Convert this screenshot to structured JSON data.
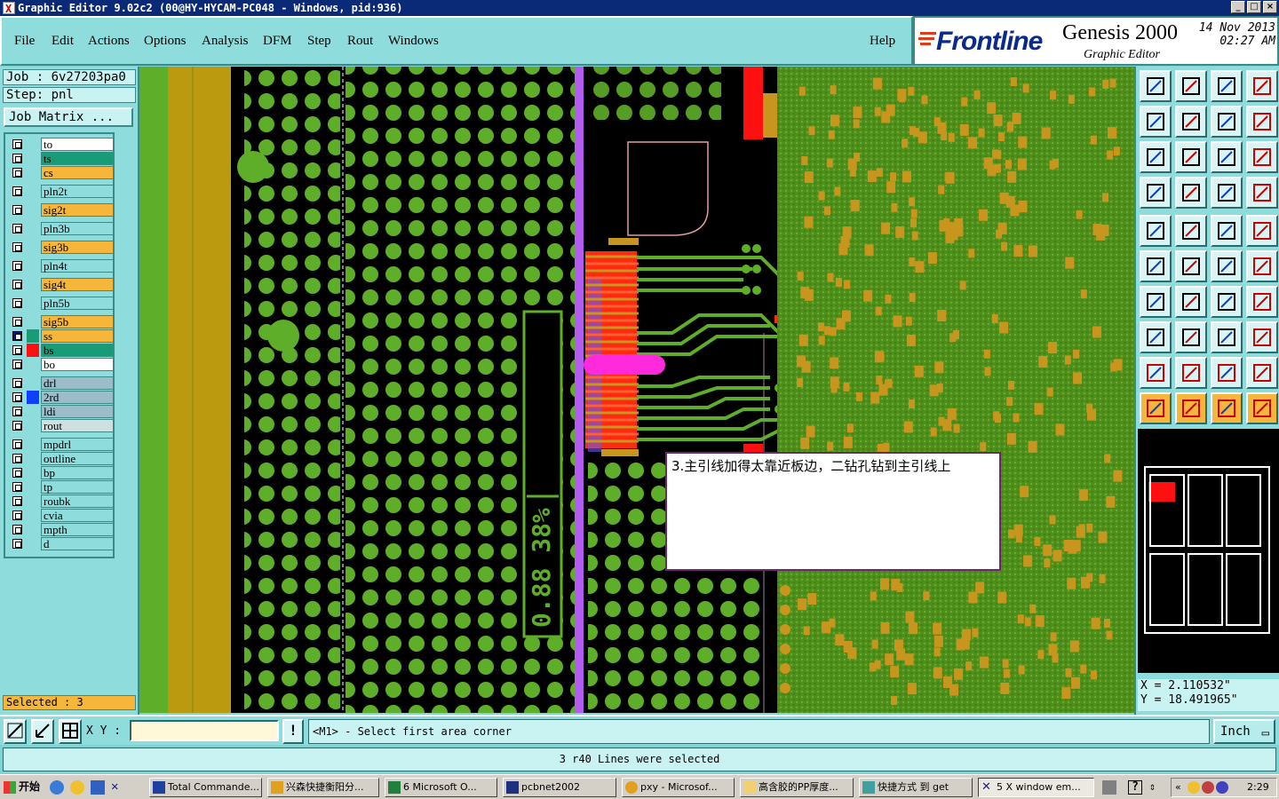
{
  "window": {
    "title": "Graphic Editor 9.02c2 (00@HY-HYCAM-PC048 - Windows, pid:936)"
  },
  "menu": {
    "items": [
      "File",
      "Edit",
      "Actions",
      "Options",
      "Analysis",
      "DFM",
      "Step",
      "Rout",
      "Windows"
    ],
    "help": "Help"
  },
  "brand": {
    "logo": "Frontline",
    "product": "Genesis 2000",
    "subtitle": "Graphic Editor",
    "date": "14 Nov 2013",
    "time": "02:27 AM"
  },
  "job": {
    "job_line": "Job : 6v27203pa0",
    "step_line": "Step: pnl",
    "matrix_button": "Job Matrix ..."
  },
  "layers": [
    {
      "name": "to",
      "color": "#ffffff"
    },
    {
      "name": "ts",
      "color": "#1a9b78"
    },
    {
      "name": "cs",
      "color": "#f5b63a"
    },
    {
      "name": "pln2t",
      "color": "#8fdcdc"
    },
    {
      "name": "sig2t",
      "color": "#f5b63a"
    },
    {
      "name": "pln3b",
      "color": "#8fdcdc"
    },
    {
      "name": "sig3b",
      "color": "#f5b63a"
    },
    {
      "name": "pln4t",
      "color": "#8fdcdc"
    },
    {
      "name": "sig4t",
      "color": "#f5b63a"
    },
    {
      "name": "pln5b",
      "color": "#8fdcdc"
    },
    {
      "name": "sig5b",
      "color": "#f5b63a"
    },
    {
      "name": "ss",
      "color": "#f5b63a"
    },
    {
      "name": "bs",
      "color": "#1a9b78"
    },
    {
      "name": "bo",
      "color": "#ffffff"
    },
    {
      "name": "drl",
      "color": "#9bbcc8"
    },
    {
      "name": "2rd",
      "color": "#9bbcc8"
    },
    {
      "name": "ldi",
      "color": "#9bbcc8"
    },
    {
      "name": "rout",
      "color": "#d0e0e0"
    },
    {
      "name": "mpdrl",
      "color": "#8fdcdc"
    },
    {
      "name": "outline",
      "color": "#8fdcdc"
    },
    {
      "name": "bp",
      "color": "#8fdcdc"
    },
    {
      "name": "tp",
      "color": "#8fdcdc"
    },
    {
      "name": "roubk",
      "color": "#8fdcdc"
    },
    {
      "name": "cvia",
      "color": "#8fdcdc"
    },
    {
      "name": "mpth",
      "color": "#8fdcdc"
    },
    {
      "name": "d",
      "color": "#8fdcdc"
    }
  ],
  "selected_status": "Selected : 3",
  "canvas": {
    "panel_text": "0.88 38%",
    "popup_text": "3.主引线加得太靠近板边，二钻孔钻到主引线上"
  },
  "coords": {
    "x": "X = 2.110532\"",
    "y": "Y = 18.491965\""
  },
  "command": {
    "xy_label": "X Y :",
    "xy_value": "",
    "prompt": "<M1> - Select first area corner",
    "unit": "Inch",
    "message": "3 r40 Lines were selected"
  },
  "taskbar": {
    "start": "开始",
    "tasks": [
      "Total Commande...",
      "兴森快捷衡阳分...",
      "6 Microsoft O...",
      "pcbnet2002",
      "pxy - Microsof...",
      "高含胶的PP厚度...",
      "快捷方式 到 get",
      "5 X window em..."
    ],
    "clock": "2:29"
  },
  "colors": {
    "panel": "#8fdcdc",
    "copper": "#c8961e",
    "plane": "#5a9b1e",
    "selected": "#ff00ff",
    "highlight": "#ff0000"
  }
}
